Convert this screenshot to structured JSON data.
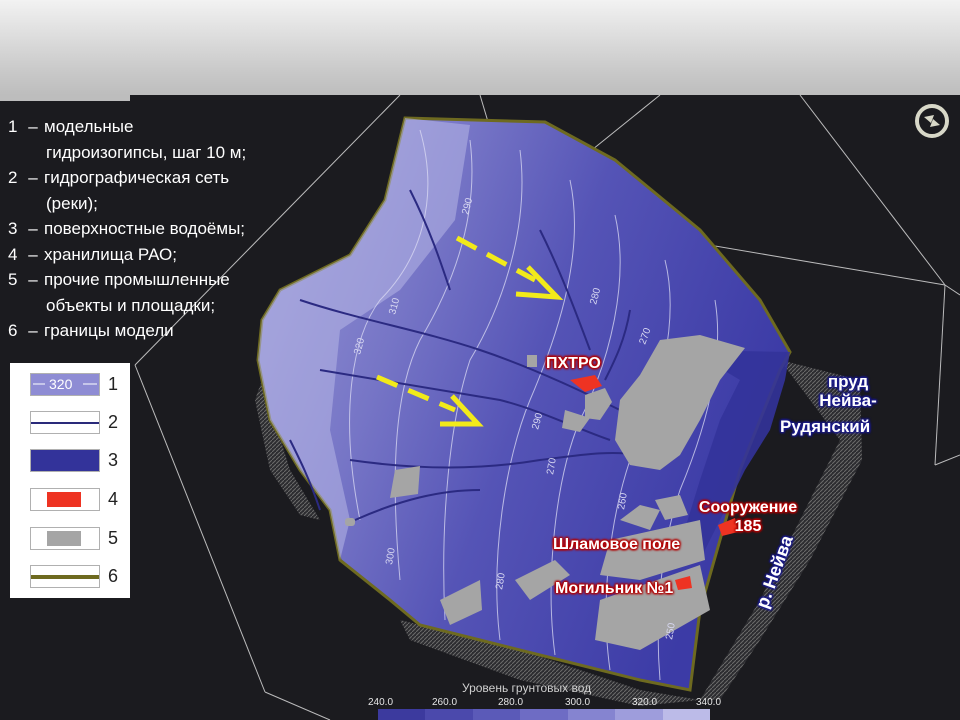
{
  "legend_text": {
    "items": [
      {
        "num": "1",
        "lines": [
          "модельные",
          "гидроизогипсы,  шаг 10 м;"
        ]
      },
      {
        "num": "2",
        "lines": [
          "гидрографическая  сеть",
          "(реки);"
        ]
      },
      {
        "num": "3",
        "lines": [
          "поверхностные  водоёмы;"
        ]
      },
      {
        "num": "4",
        "lines": [
          "хранилища  РАО;"
        ]
      },
      {
        "num": "5",
        "lines": [
          "прочие промышленные",
          "объекты и площадки;"
        ]
      },
      {
        "num": "6",
        "lines": [
          "границы модели"
        ]
      }
    ]
  },
  "legend_box": {
    "contour_sample_label": "320",
    "rows": [
      "1",
      "2",
      "3",
      "4",
      "5",
      "6"
    ],
    "colors": {
      "contour_band": "#8e8cd4",
      "river": "#2a2a7a",
      "water": "#33339a",
      "rao": "#ee3322",
      "industrial": "#a5a5a5",
      "boundary": "#6e6a20"
    }
  },
  "map_labels": {
    "pkhtro": "ПХТРО",
    "pond": [
      "пруд",
      "Нейва-",
      "Рудянский"
    ],
    "structure": [
      "Сооружение",
      "185"
    ],
    "sludge": "Шламовое поле",
    "burial": "Могильник №1",
    "river": "р. Нейва"
  },
  "contour_labels": [
    "320",
    "310",
    "300",
    "290",
    "280",
    "280",
    "270",
    "260",
    "250",
    "290",
    "270"
  ],
  "colorbar": {
    "title": "Уровень грунтовых вод",
    "ticks": [
      "240.0",
      "260.0",
      "280.0",
      "300.0",
      "320.0",
      "340.0"
    ],
    "colors": [
      "#3c3a9e",
      "#4b49ac",
      "#5b5ab8",
      "#6e6cc4",
      "#8584d0",
      "#9e9ddc",
      "#bcbbe8"
    ]
  },
  "colors": {
    "background": "#1b1b1f",
    "map_fill": "#4d4cb3",
    "map_light": "#8a89cf",
    "arrow": "#f2ea1a"
  },
  "icons": [
    "refresh-icon"
  ]
}
